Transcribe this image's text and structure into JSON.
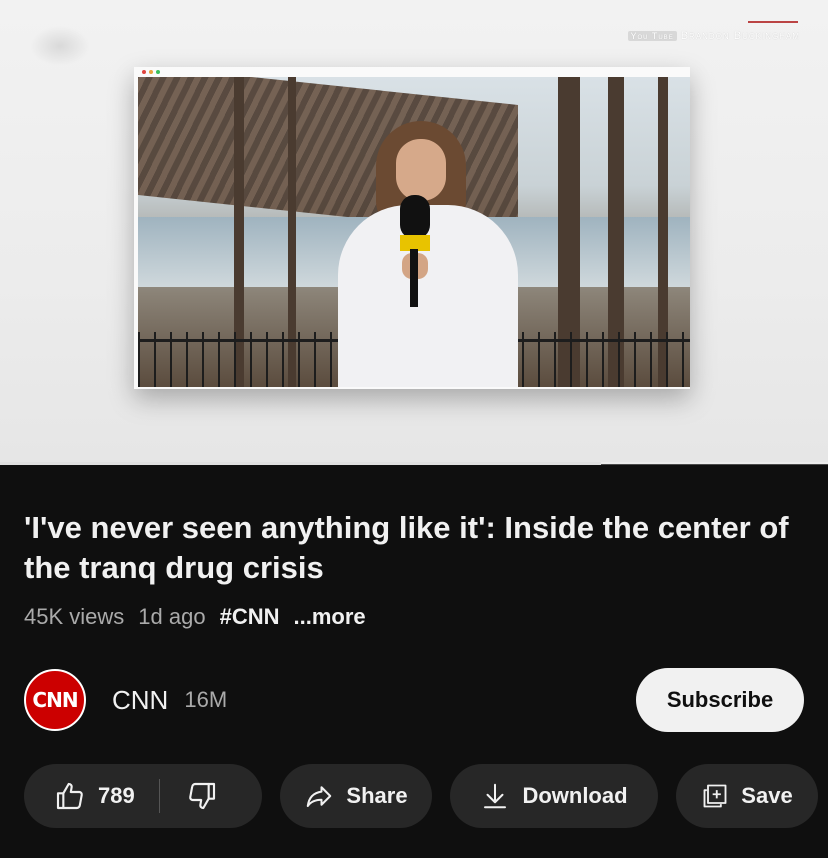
{
  "player": {
    "watermark_text": "Brandon Buckingham",
    "watermark_logo": "You Tube",
    "progress_fraction": 0.726
  },
  "video": {
    "title": "'I've never seen anything like it': Inside the center of the tranq drug crisis",
    "views": "45K views",
    "age": "1d ago",
    "hashtag": "#CNN",
    "more": "...more"
  },
  "channel": {
    "avatar_text": "CNN",
    "name": "CNN",
    "subscribers": "16M",
    "subscribe_label": "Subscribe"
  },
  "actions": {
    "likes": "789",
    "share_label": "Share",
    "download_label": "Download",
    "save_label": "Save"
  },
  "icons": {
    "like": "thumbs-up-icon",
    "dislike": "thumbs-down-icon",
    "share": "share-arrow-icon",
    "download": "download-icon",
    "save": "save-playlist-icon"
  },
  "colors": {
    "background": "#0f0f0f",
    "pill": "#272727",
    "cnn_red": "#cc0000",
    "subscribe_bg": "#f1f1f1"
  }
}
